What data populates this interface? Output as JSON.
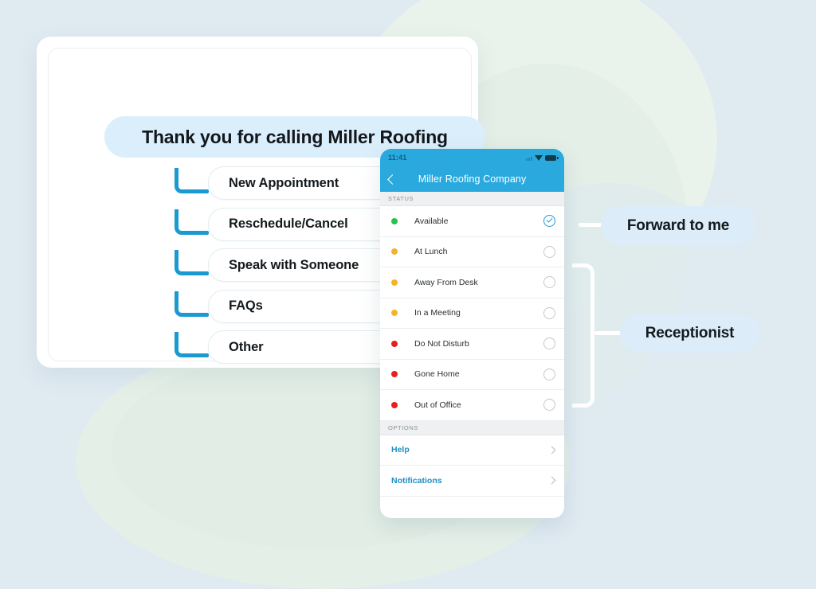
{
  "colors": {
    "background": "#dfeaf1",
    "blob_green": "#e4efe7",
    "accent_blue": "#1b9ad1",
    "phone_header": "#29a9dd",
    "pill_blue": "#dbeefb",
    "text_dark": "#14191d",
    "status_green": "#29c24a",
    "status_yellow": "#f5b426",
    "status_red": "#e8201c"
  },
  "ivr_card": {
    "greeting": "Thank you for calling Miller Roofing",
    "menu_items": [
      {
        "label": "New Appointment"
      },
      {
        "label": "Reschedule/Cancel"
      },
      {
        "label": "Speak with Someone"
      },
      {
        "label": "FAQs"
      },
      {
        "label": "Other"
      }
    ]
  },
  "phone": {
    "statusbar": {
      "time": "11:41",
      "icons": [
        "signal-icon",
        "wifi-icon",
        "battery-icon"
      ]
    },
    "header": {
      "back_icon": "chevron-left-icon",
      "title": "Miller Roofing Company"
    },
    "status_section": {
      "header": "STATUS",
      "rows": [
        {
          "label": "Available",
          "dot": "#29c24a",
          "selected": true
        },
        {
          "label": "At Lunch",
          "dot": "#f5b426",
          "selected": false
        },
        {
          "label": "Away From Desk",
          "dot": "#f5b426",
          "selected": false
        },
        {
          "label": "In a Meeting",
          "dot": "#f5b426",
          "selected": false
        },
        {
          "label": "Do Not Disturb",
          "dot": "#e8201c",
          "selected": false
        },
        {
          "label": "Gone Home",
          "dot": "#e8201c",
          "selected": false
        },
        {
          "label": "Out of Office",
          "dot": "#e8201c",
          "selected": false
        }
      ]
    },
    "options_section": {
      "header": "OPTIONS",
      "rows": [
        {
          "label": "Help"
        },
        {
          "label": "Notifications"
        }
      ]
    }
  },
  "callouts": {
    "forward": "Forward to me",
    "receptionist": "Receptionist"
  }
}
